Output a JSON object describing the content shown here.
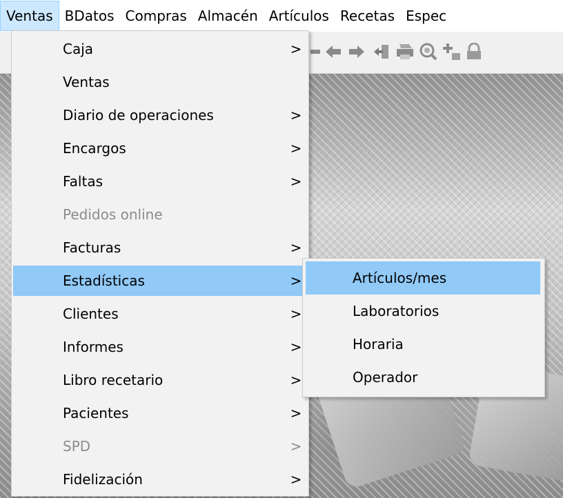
{
  "menubar": {
    "items": [
      {
        "label": "Ventas"
      },
      {
        "label": "BDatos"
      },
      {
        "label": "Compras"
      },
      {
        "label": "Almacén"
      },
      {
        "label": "Artículos"
      },
      {
        "label": "Recetas"
      },
      {
        "label": "Espec"
      }
    ]
  },
  "toolbar": {
    "icons": [
      "arrow-left-icon",
      "arrow-right-icon",
      "import-icon",
      "print-icon",
      "search-icon",
      "add-icon",
      "lock-icon"
    ]
  },
  "menu": {
    "items": [
      {
        "label": "Caja",
        "arrow": ">"
      },
      {
        "label": "Ventas",
        "arrow": ""
      },
      {
        "label": "Diario de operaciones",
        "arrow": ">"
      },
      {
        "label": "Encargos",
        "arrow": ">"
      },
      {
        "label": "Faltas",
        "arrow": ">"
      },
      {
        "label": "Pedidos online",
        "arrow": ""
      },
      {
        "label": "Facturas",
        "arrow": ">"
      },
      {
        "label": "Estadísticas",
        "arrow": ">"
      },
      {
        "label": "Clientes",
        "arrow": ">"
      },
      {
        "label": "Informes",
        "arrow": ">"
      },
      {
        "label": "Libro recetario",
        "arrow": ">"
      },
      {
        "label": "Pacientes",
        "arrow": ">"
      },
      {
        "label": "SPD",
        "arrow": ">"
      },
      {
        "label": "Fidelización",
        "arrow": ">"
      }
    ]
  },
  "submenu": {
    "items": [
      {
        "label": "Artículos/mes"
      },
      {
        "label": "Laboratorios"
      },
      {
        "label": "Horaria"
      },
      {
        "label": "Operador"
      }
    ]
  },
  "colors": {
    "highlight": "#91c9f7",
    "menubar_active": "#cce8ff",
    "disabled_text": "#8c8c8c"
  }
}
